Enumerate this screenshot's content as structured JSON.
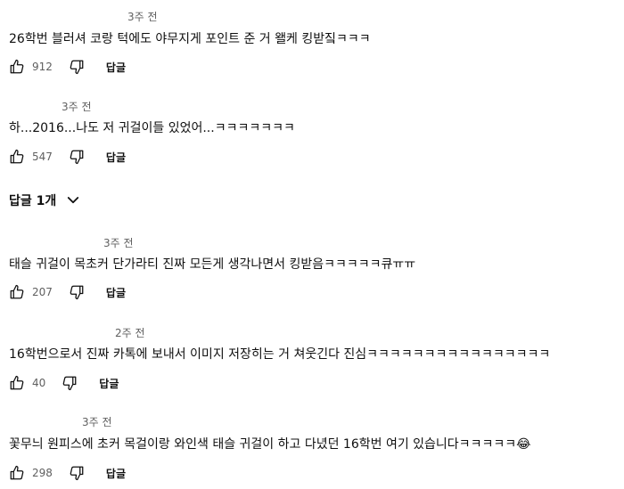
{
  "comments": [
    {
      "time": "3주 전",
      "text": "26학번 블러셔 코랑 턱에도 야무지게 포인트 준 거 왤케 킹받짘ㅋㅋㅋ",
      "likes": "912",
      "reply_label": "답글"
    },
    {
      "time": "3주 전",
      "text": "하...2016...나도 저 귀걸이들 있었어...ㅋㅋㅋㅋㅋㅋㅋ",
      "likes": "547",
      "reply_label": "답글"
    },
    {
      "time": "3주 전",
      "text": "태슬 귀걸이 목초커 단가라티 진짜 모든게 생각나면서 킹받음ㅋㅋㅋㅋㅋ큐ㅠㅠ",
      "likes": "207",
      "reply_label": "답글"
    },
    {
      "time": "2주 전",
      "text": "16학번으로서 진짜 카톡에 보내서 이미지 저장히는 거 쳐웃긴다 진심ㅋㅋㅋㅋㅋㅋㅋㅋㅋㅋㅋㅋㅋㅋㅋㅋ",
      "likes": "40",
      "reply_label": "답글"
    },
    {
      "time": "3주 전",
      "text": "꽃무늬 원피스에 초커 목걸이랑 와인색 태슬 귀걸이 하고 다녔던 16학번 여기 있습니다ㅋㅋㅋㅋㅋ😂",
      "likes": "298",
      "reply_label": "답글"
    }
  ],
  "replies_toggle": {
    "label": "답글 1개"
  },
  "icons": {
    "like": "thumb-up-icon",
    "dislike": "thumb-down-icon",
    "expand": "chevron-down-icon"
  }
}
